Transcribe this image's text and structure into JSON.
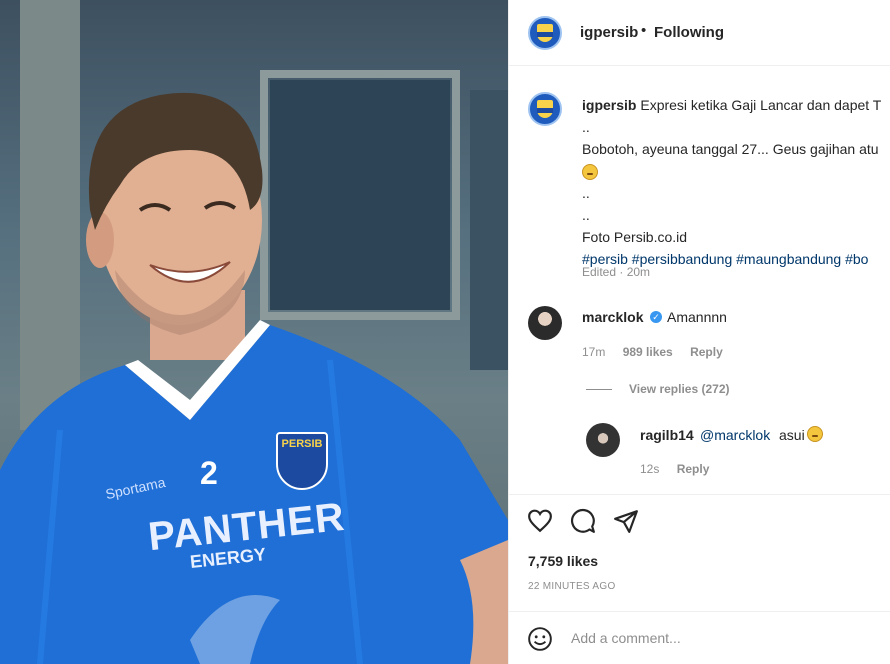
{
  "post": {
    "username": "igpersib",
    "follow_status": "Following",
    "caption_line1": "Expresi ketika Gaji Lancar dan dapet T",
    "caption_line2": "..",
    "caption_line3": "Bobotoh, ayeuna tanggal 27... Geus gajihan atu",
    "caption_line4": "..",
    "caption_line5": "..",
    "caption_line6": "Foto Persib.co.id",
    "hashtags": "#persib #persibbandung #maungbandung #bo",
    "edited_meta": "Edited · 20m",
    "likes": "7,759 likes",
    "timestamp": "22 MINUTES AGO",
    "comment_placeholder": "Add a comment..."
  },
  "comments": [
    {
      "user": "marcklok",
      "text": "Amannnn",
      "time": "17m",
      "likes": "989 likes",
      "reply": "Reply",
      "view_replies": "View replies (272)"
    },
    {
      "user": "ragilb14",
      "mention": "@marcklok",
      "text": "asui",
      "time": "12s",
      "reply": "Reply"
    }
  ],
  "photo": {
    "jersey_number": "2",
    "jersey_brand": "Sportama",
    "sponsor": "PANTHER",
    "sponsor_sub": "ENERGY",
    "crest": "PERSIB"
  },
  "colors": {
    "jersey": "#1f6fd6",
    "link": "#00376b",
    "meta": "#8e8e8e",
    "verified": "#3897f0"
  }
}
